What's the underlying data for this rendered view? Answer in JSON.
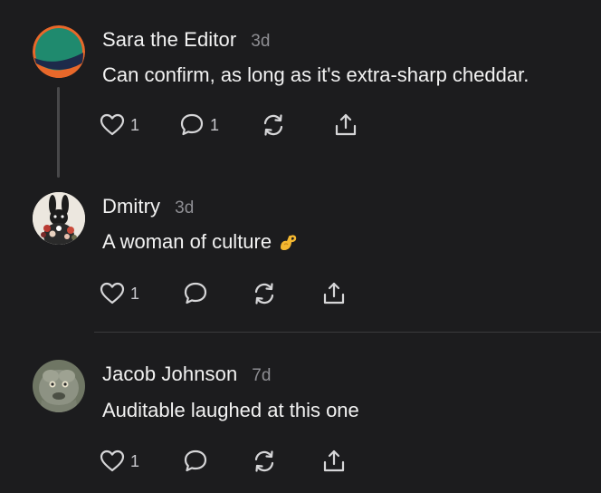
{
  "comments": [
    {
      "author": "Sara the Editor",
      "time": "3d",
      "text": "Can confirm, as long as it's extra-sharp cheddar.",
      "likes": "1",
      "replies": "1",
      "avatar_icon": "green-orange-circle-logo"
    },
    {
      "author": "Dmitry",
      "time": "3d",
      "text": "A woman of culture",
      "emoji": "pinching-hand-emoji",
      "likes": "1",
      "replies": "",
      "avatar_icon": "rabbit-with-flowers-avatar"
    },
    {
      "author": "Jacob Johnson",
      "time": "7d",
      "text": "Auditable laughed at this one",
      "likes": "1",
      "replies": "",
      "avatar_icon": "furry-creature-avatar"
    }
  ],
  "colors": {
    "background": "#1c1c1e",
    "text": "#f2f2f2",
    "muted": "#8e8e93",
    "icon": "#d6d6d8"
  }
}
